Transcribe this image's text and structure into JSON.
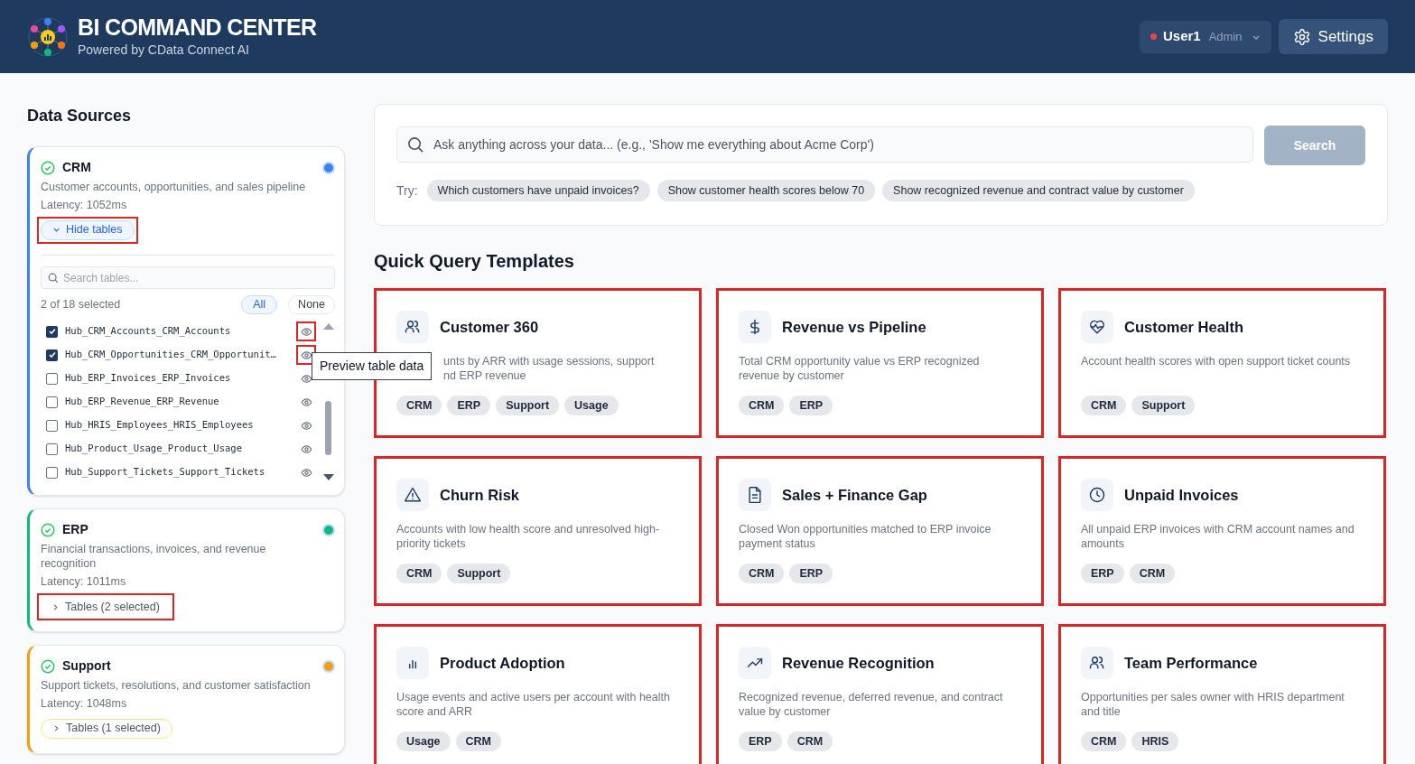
{
  "header": {
    "title": "BI COMMAND CENTER",
    "subtitle": "Powered by CData Connect AI",
    "user": {
      "name": "User1",
      "role": "Admin"
    },
    "settings_button": "Settings"
  },
  "data_sources": {
    "heading": "Data Sources",
    "sources": [
      {
        "name": "CRM",
        "description": "Customer accounts, opportunities, and sales pipeline",
        "latency": "Latency: 1052ms",
        "color": "#3b82f6",
        "expanded": true,
        "toggle": "Hide tables",
        "highlighted": true,
        "table_search": {
          "placeholder": "Search tables..."
        },
        "count": "2 of 18 selected",
        "all_button": "All",
        "none_button": "None",
        "tables": [
          {
            "name": "Hub_CRM_Accounts_CRM_Accounts",
            "checked": true,
            "highlighted": true
          },
          {
            "name": "Hub_CRM_Opportunities_CRM_Opportunit…",
            "checked": true,
            "highlighted": true
          },
          {
            "name": "Hub_ERP_Invoices_ERP_Invoices",
            "checked": false,
            "highlighted": false
          },
          {
            "name": "Hub_ERP_Revenue_ERP_Revenue",
            "checked": false,
            "highlighted": false
          },
          {
            "name": "Hub_HRIS_Employees_HRIS_Employees",
            "checked": false,
            "highlighted": false
          },
          {
            "name": "Hub_Product_Usage_Product_Usage",
            "checked": false,
            "highlighted": false
          },
          {
            "name": "Hub_Support_Tickets_Support_Tickets",
            "checked": false,
            "highlighted": false
          }
        ]
      },
      {
        "name": "ERP",
        "description": "Financial transactions, invoices, and revenue recognition",
        "latency": "Latency: 1011ms",
        "color": "#10b981",
        "expanded": false,
        "toggle": "Tables (2 selected)",
        "highlighted": true
      },
      {
        "name": "Support",
        "description": "Support tickets, resolutions, and customer satisfaction",
        "latency": "Latency: 1048ms",
        "color": "#f59e0b",
        "expanded": false,
        "toggle": "Tables (1 selected)",
        "highlighted": false
      }
    ]
  },
  "tooltip": "Preview table data",
  "search": {
    "placeholder": "Ask anything across your data... (e.g., 'Show me everything about Acme Corp')",
    "button": "Search",
    "try_label": "Try:",
    "suggestions": [
      "Which customers have unpaid invoices?",
      "Show customer health scores below 70",
      "Show recognized revenue and contract value by customer"
    ]
  },
  "templates": {
    "heading": "Quick Query Templates",
    "cards": [
      {
        "title": "Customer 360",
        "description_lines": [
          "unts by ARR with usage sessions, support",
          "nd ERP revenue"
        ],
        "tags": [
          "CRM",
          "ERP",
          "Support",
          "Usage"
        ],
        "highlighted": true
      },
      {
        "title": "Revenue vs Pipeline",
        "description_lines": [
          "Total CRM opportunity value vs ERP recognized",
          "revenue by customer"
        ],
        "tags": [
          "CRM",
          "ERP"
        ],
        "highlighted": true
      },
      {
        "title": "Customer Health",
        "description_lines": [
          "Account health scores with open support ticket counts"
        ],
        "tags": [
          "CRM",
          "Support"
        ],
        "highlighted": true
      },
      {
        "title": "Churn Risk",
        "description_lines": [
          "Accounts with low health score and unresolved high-",
          "priority tickets"
        ],
        "tags": [
          "CRM",
          "Support"
        ],
        "highlighted": true
      },
      {
        "title": "Sales + Finance Gap",
        "description_lines": [
          "Closed Won opportunities matched to ERP invoice",
          "payment status"
        ],
        "tags": [
          "CRM",
          "ERP"
        ],
        "highlighted": true
      },
      {
        "title": "Unpaid Invoices",
        "description_lines": [
          "All unpaid ERP invoices with CRM account names and",
          "amounts"
        ],
        "tags": [
          "ERP",
          "CRM"
        ],
        "highlighted": true
      },
      {
        "title": "Product Adoption",
        "description_lines": [
          "Usage events and active users per account with health",
          "score and ARR"
        ],
        "tags": [
          "Usage",
          "CRM"
        ],
        "highlighted": true
      },
      {
        "title": "Revenue Recognition",
        "description_lines": [
          "Recognized revenue, deferred revenue, and contract",
          "value by customer"
        ],
        "tags": [
          "ERP",
          "CRM"
        ],
        "highlighted": true
      },
      {
        "title": "Team Performance",
        "description_lines": [
          "Opportunities per sales owner with HRIS department",
          "and title"
        ],
        "tags": [
          "CRM",
          "HRIS"
        ],
        "highlighted": true
      }
    ]
  }
}
